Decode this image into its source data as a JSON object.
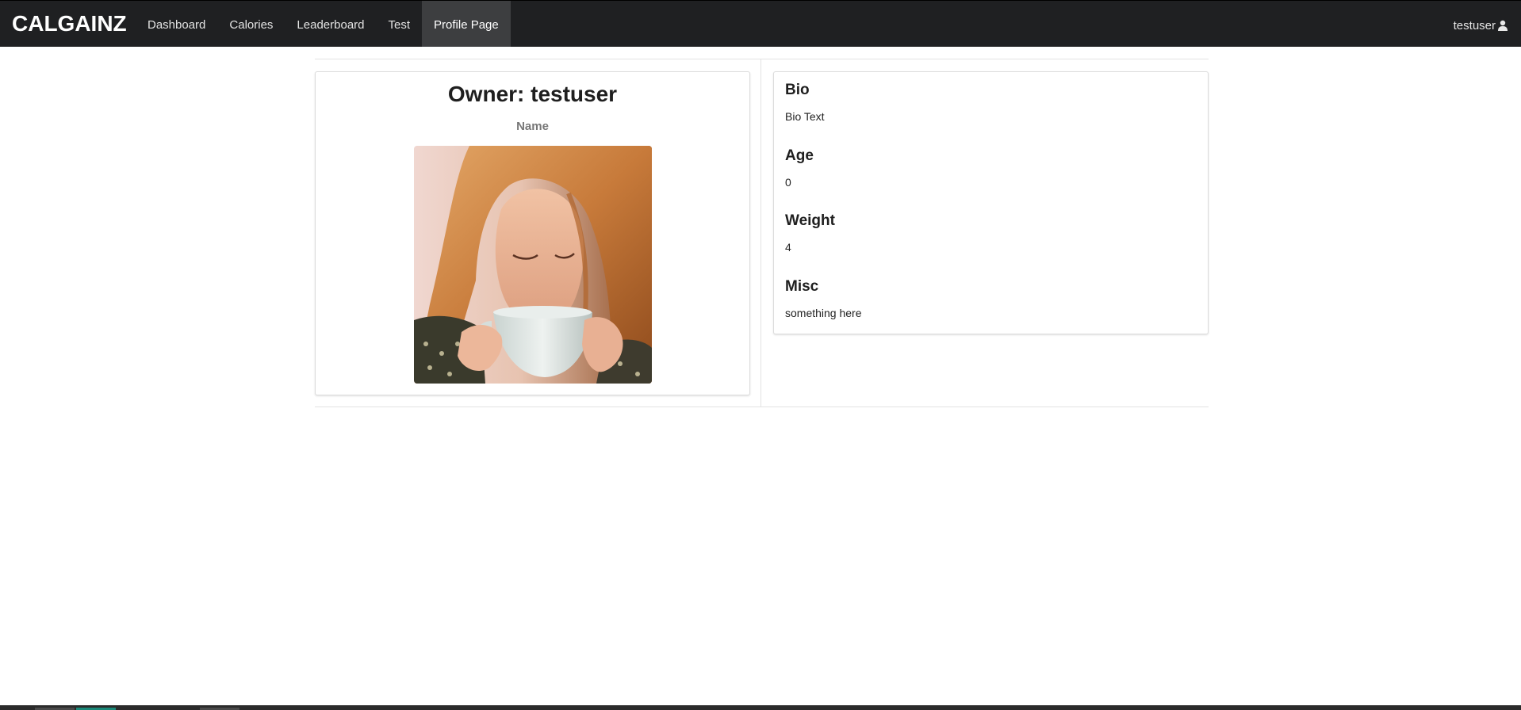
{
  "navbar": {
    "brand": "CALGAINZ",
    "items": [
      {
        "label": "Dashboard",
        "active": false
      },
      {
        "label": "Calories",
        "active": false
      },
      {
        "label": "Leaderboard",
        "active": false
      },
      {
        "label": "Test",
        "active": false
      },
      {
        "label": "Profile Page",
        "active": true
      }
    ],
    "user": {
      "username": "testuser",
      "icon": "user-icon"
    }
  },
  "profile": {
    "owner_title": "Owner: testuser",
    "name_label": "Name",
    "photo_alt": "Profile photo"
  },
  "details": {
    "bio": {
      "heading": "Bio",
      "value": "Bio Text"
    },
    "age": {
      "heading": "Age",
      "value": "0"
    },
    "weight": {
      "heading": "Weight",
      "value": "4"
    },
    "misc": {
      "heading": "Misc",
      "value": "something here"
    }
  },
  "colors": {
    "navbar_bg": "#1f2022",
    "nav_active_bg": "#3d3e40",
    "taskbar_accent": "#1b8a7a"
  }
}
